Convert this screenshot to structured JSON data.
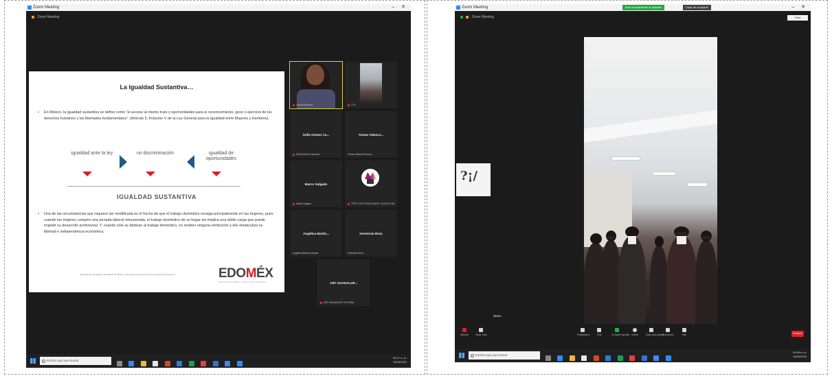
{
  "left": {
    "window_title": "Zoom Meeting",
    "meeting_label": "Zoom Meeting",
    "slide": {
      "title": "La Igualdad Sustantiva…",
      "paragraph1": "En México, la igualdad sustantiva se define como \"el acceso al mismo trato y oportunidades para el reconocimiento, goce o ejercicio de los derechos humanos y las libertades fundamentales\". (Artículo 5, Fracción V de la Ley General para la Igualdad entre Mujeres y Hombres).",
      "concept1": "igualdad ante la ley",
      "concept2": "no discriminación",
      "concept3": "igualdad de oportunidades",
      "subtitle": "IGUALDAD SUSTANTIVA",
      "paragraph2": "Una de las circunstancias que requiere ser modificada es el hecho de que el trabajo doméstico recaiga principalmente en las mujeres, pues cuando las mujeres cumplen una jornada laboral remunerada, el trabajo doméstico de su hogar les implica una doble carga que puede impedir su desarrollo profesional. Y, cuando sólo se dedican al trabajo doméstico, no reciben ninguna retribución y ello obstaculiza su libertad e independencia económica.",
      "footnote": "Secretaría de las Mujeres del Estado de México, Guía para la incorporación de la perspectiva de género.",
      "brand_pre": "EDO",
      "brand_m": "M",
      "brand_post": "ÉX",
      "brand_tagline": "DECISIONES FIRMES, RESULTADOS FUERTES"
    },
    "participants": [
      {
        "name": "",
        "sub": "Lizbeth Martínez"
      },
      {
        "name": "",
        "sub": "3° B"
      },
      {
        "name": "Sofía Gómez Ca...",
        "sub": "Sofía Gómez Camacho"
      },
      {
        "name": "Tomas Velasco...",
        "sub": "Tomas Velasco Recinos"
      },
      {
        "name": "Marco Salgado",
        "sub": "Marco Salgado"
      },
      {
        "name": "",
        "sub": "TSPF/ CECYTEM PLANTEL CUAUTITLÁN"
      },
      {
        "name": "Angélica Martín...",
        "sub": "Angélica Martínez Acosta"
      },
      {
        "name": "Hortensia Reza",
        "sub": "Hortensia Reza"
      },
      {
        "name": "CBT GUADALUP...",
        "sub": "CBT GUADALUPE VICTORIA"
      }
    ],
    "taskbar": {
      "search_placeholder": "Escribe aquí para buscar",
      "time": "09:47 a. m.",
      "date": "19/05/2022"
    }
  },
  "right": {
    "window_title": "Zoom Meeting",
    "meeting_label": "Zoom Meeting",
    "share_notice": "Está compartiendo la pantalla",
    "stop_share": "Dejar de compartir",
    "view_button": "Vista",
    "camera_label": "aksec",
    "controls": [
      {
        "label": "Silenciar"
      },
      {
        "label": "Iniciar video"
      },
      {
        "label": "Participantes"
      },
      {
        "label": "Chat"
      },
      {
        "label": "Compartir pantalla"
      },
      {
        "label": "Grabar"
      },
      {
        "label": "Salas para grupos"
      },
      {
        "label": "Reacciones"
      },
      {
        "label": "Más"
      }
    ],
    "left_controls": [
      {
        "label": "Silenciar"
      },
      {
        "label": "Iniciar video"
      }
    ],
    "leave_label": "Finalizar",
    "taskbar": {
      "search_placeholder": "Escribe aquí para buscar",
      "time": "09:48 a. m.",
      "date": "19/05/2022"
    }
  }
}
